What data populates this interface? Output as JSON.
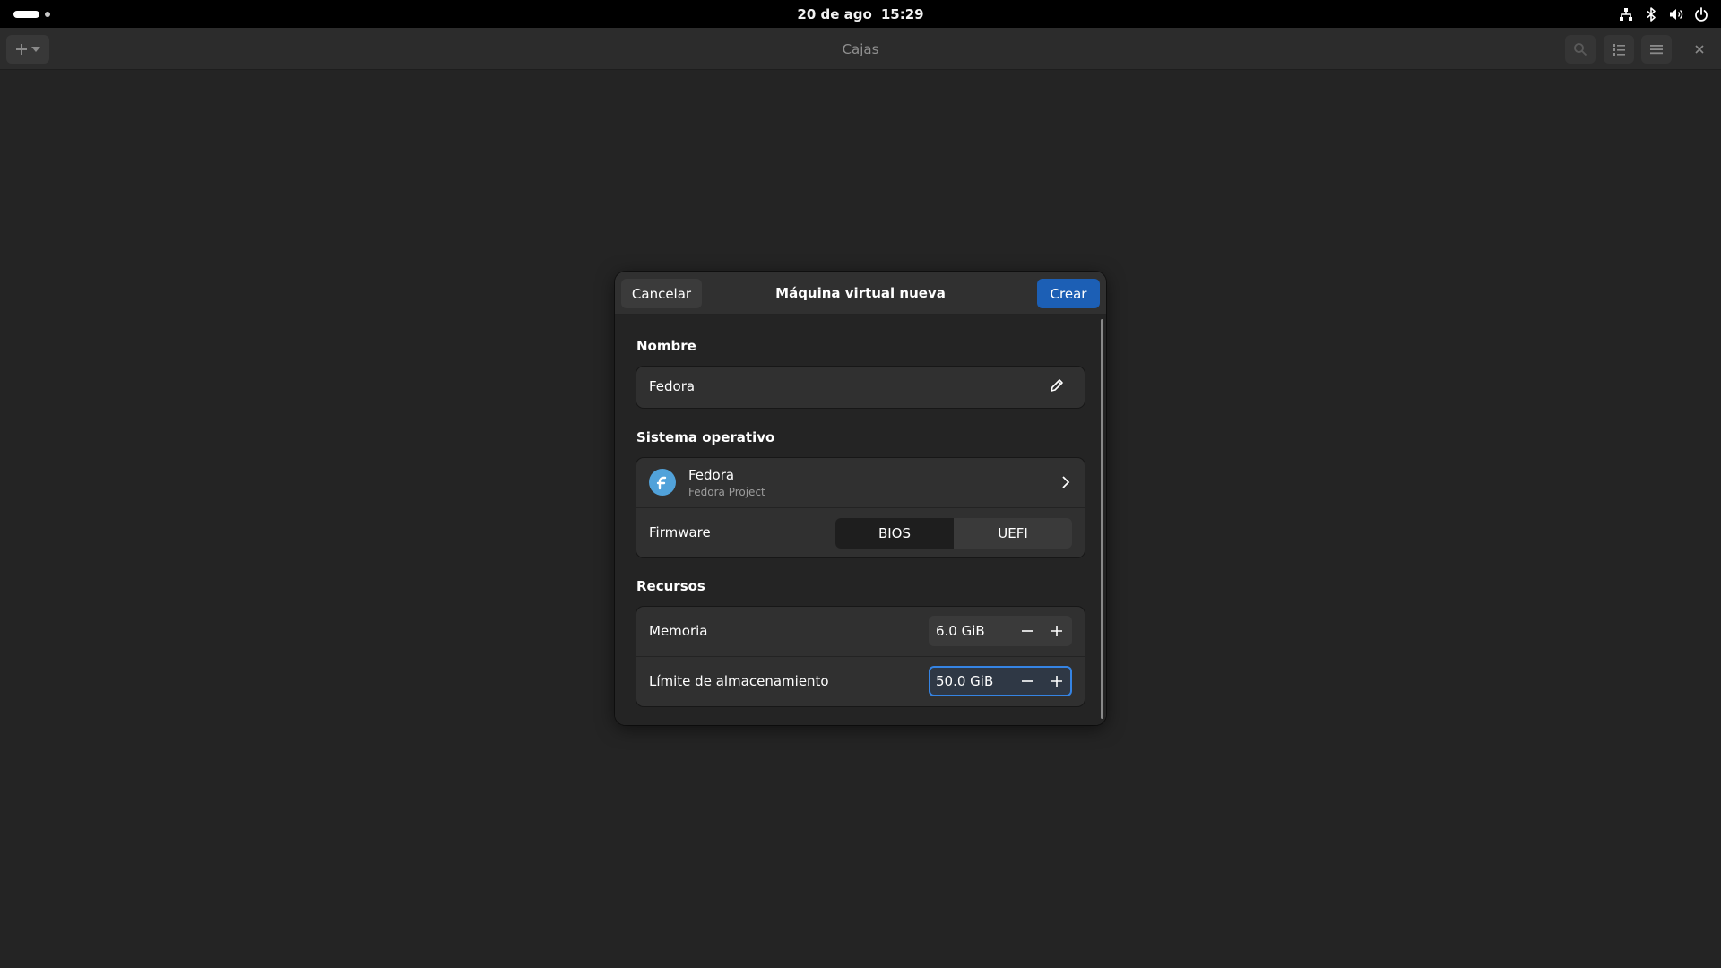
{
  "topbar": {
    "date": "20 de ago",
    "time": "15:29",
    "tray_icons": [
      "network-wired-icon",
      "bluetooth-icon",
      "volume-icon",
      "power-icon"
    ]
  },
  "header": {
    "title": "Cajas",
    "new_button_icon": "plus-icon",
    "buttons": [
      "search-icon",
      "list-view-icon",
      "menu-icon",
      "close-icon"
    ]
  },
  "dialog": {
    "title": "Máquina virtual nueva",
    "cancel_label": "Cancelar",
    "create_label": "Crear",
    "name_section": {
      "label": "Nombre",
      "value": "Fedora"
    },
    "os_section": {
      "label": "Sistema operativo",
      "os_name": "Fedora",
      "os_vendor": "Fedora Project",
      "firmware_label": "Firmware",
      "firmware_options": [
        "BIOS",
        "UEFI"
      ],
      "firmware_selected": "BIOS"
    },
    "resources_section": {
      "label": "Recursos",
      "memory_label": "Memoria",
      "memory_value": "6.0 GiB",
      "storage_label": "Límite de almacenamiento",
      "storage_value": "50.0 GiB"
    }
  },
  "colors": {
    "accent": "#1c5fb5",
    "focus": "#3584e4",
    "fedora_blue": "#51a2da",
    "background": "#242424"
  }
}
